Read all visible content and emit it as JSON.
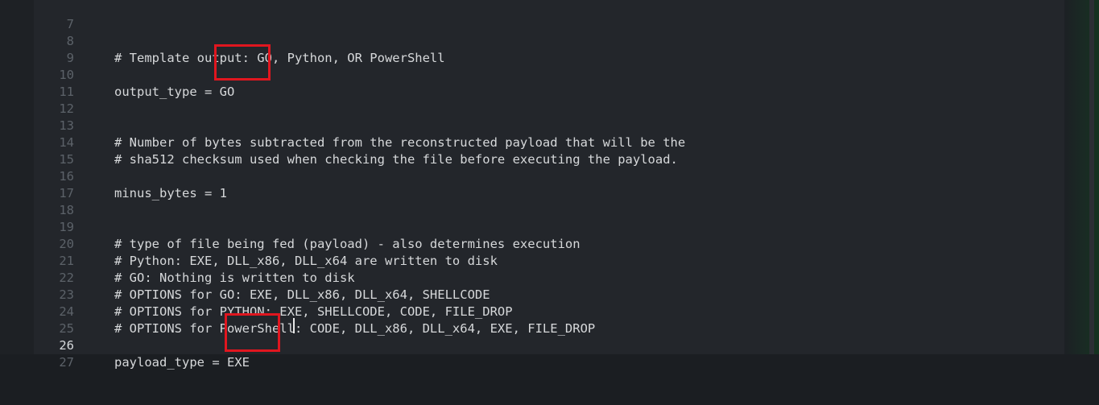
{
  "editor": {
    "lines": [
      {
        "num": "7",
        "text": ""
      },
      {
        "num": "8",
        "text": "# Template output: GO, Python, OR PowerShell"
      },
      {
        "num": "9",
        "text": ""
      },
      {
        "num": "10",
        "text": "output_type = GO"
      },
      {
        "num": "11",
        "text": ""
      },
      {
        "num": "12",
        "text": ""
      },
      {
        "num": "13",
        "text": "# Number of bytes subtracted from the reconstructed payload that will be the"
      },
      {
        "num": "14",
        "text": "# sha512 checksum used when checking the file before executing the payload."
      },
      {
        "num": "15",
        "text": ""
      },
      {
        "num": "16",
        "text": "minus_bytes = 1"
      },
      {
        "num": "17",
        "text": ""
      },
      {
        "num": "18",
        "text": ""
      },
      {
        "num": "19",
        "text": "# type of file being fed (payload) - also determines execution"
      },
      {
        "num": "20",
        "text": "# Python: EXE, DLL_x86, DLL_x64 are written to disk"
      },
      {
        "num": "21",
        "text": "# GO: Nothing is written to disk"
      },
      {
        "num": "22",
        "text": "# OPTIONS for GO: EXE, DLL_x86, DLL_x64, SHELLCODE"
      },
      {
        "num": "23",
        "text": "# OPTIONS for PYTHON: EXE, SHELLCODE, CODE, FILE_DROP"
      },
      {
        "num": "24",
        "text": "# OPTIONS for PowerShell: CODE, DLL_x86, DLL_x64, EXE, FILE_DROP"
      },
      {
        "num": "25",
        "text": ""
      },
      {
        "num": "26",
        "text": "payload_type = EXE"
      },
      {
        "num": "27",
        "text": ""
      }
    ],
    "current_line": "26"
  },
  "colors": {
    "highlight_box": "#e0161f",
    "code_text": "#d6d8da",
    "line_number": "#5c6269",
    "editor_bg": "#23262b"
  }
}
